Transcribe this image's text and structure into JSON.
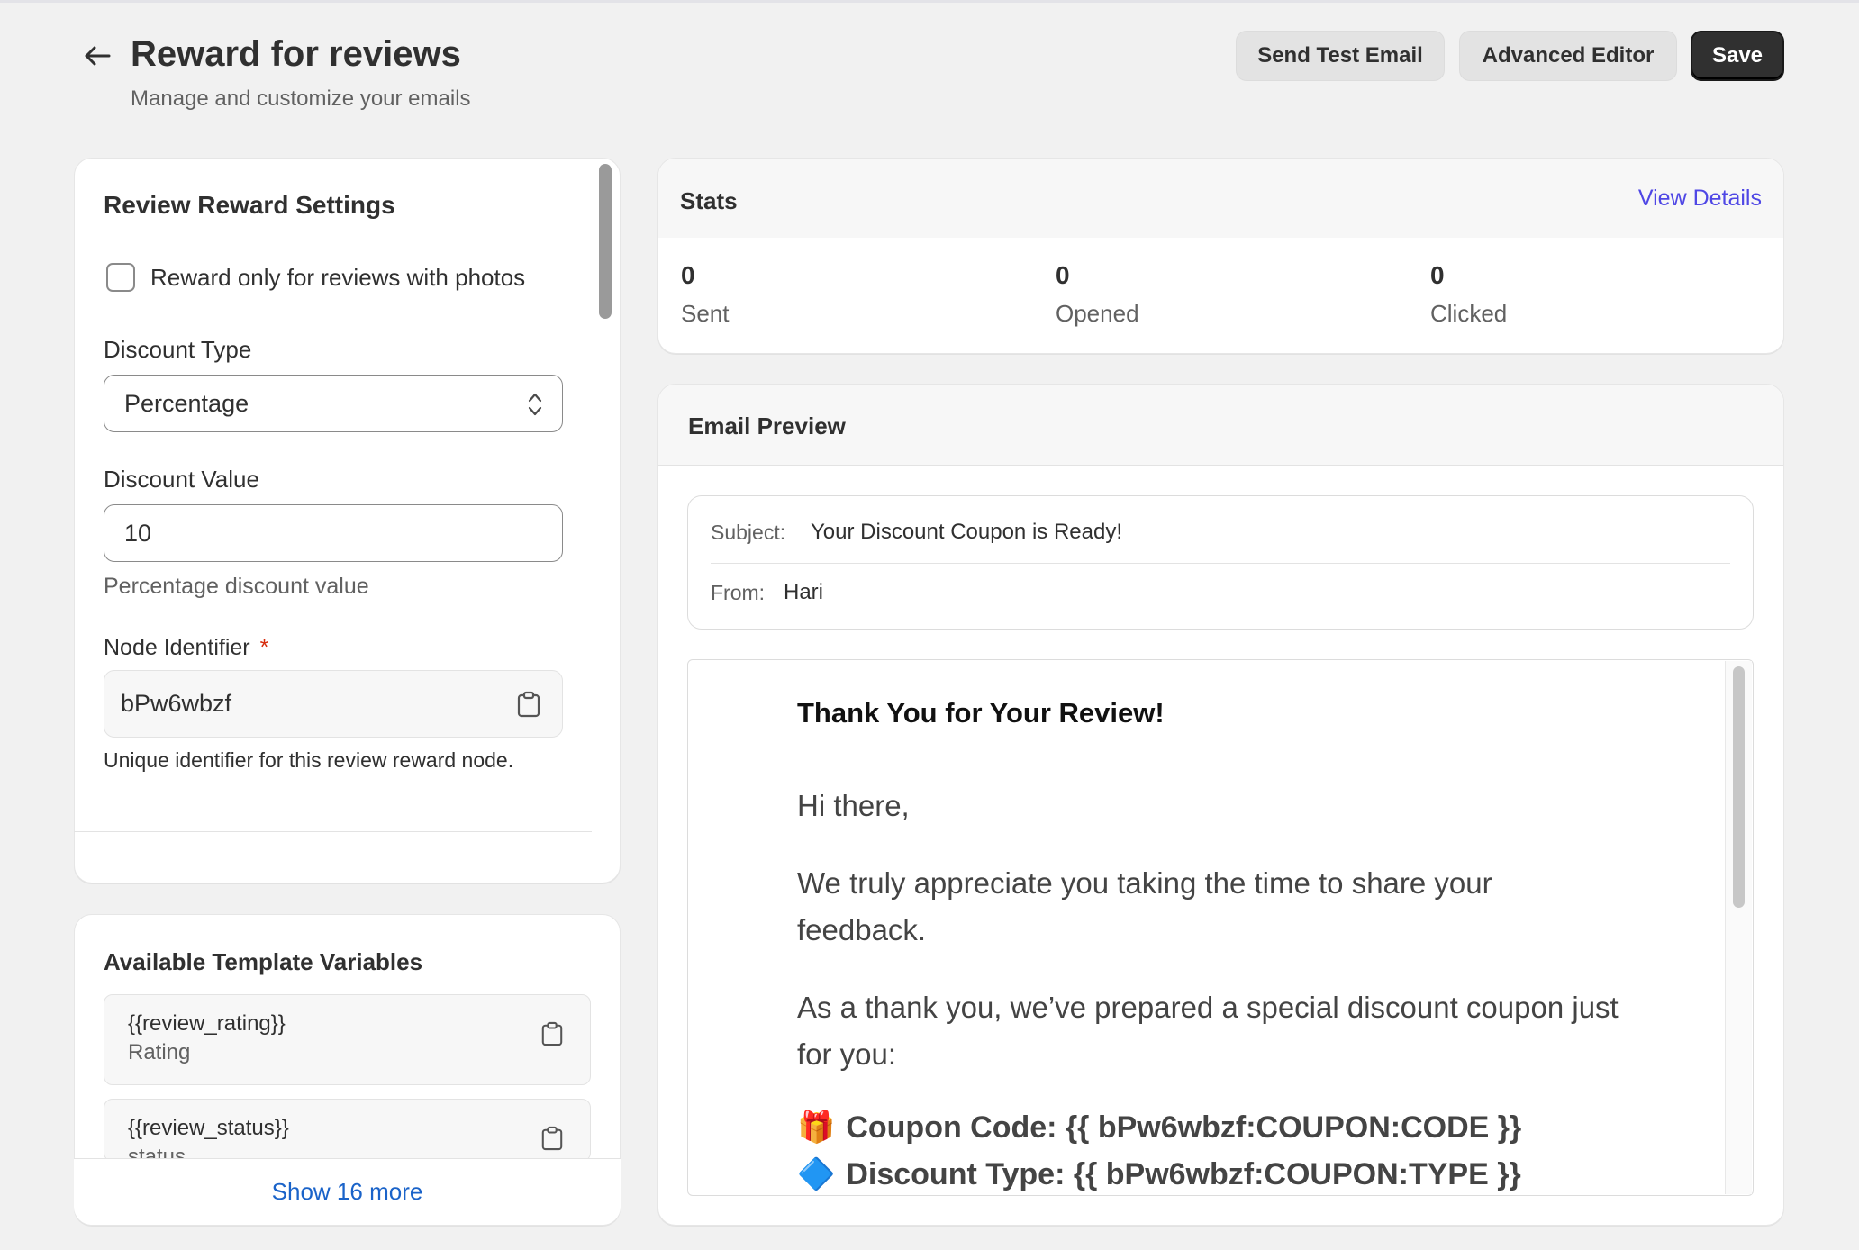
{
  "header": {
    "title": "Reward for reviews",
    "subtitle": "Manage and customize your emails",
    "send_test_label": "Send Test Email",
    "advanced_editor_label": "Advanced Editor",
    "save_label": "Save"
  },
  "settings": {
    "title": "Review Reward Settings",
    "photos_only_label": "Reward only for reviews with photos",
    "photos_only_checked": false,
    "discount_type_label": "Discount Type",
    "discount_type_value": "Percentage",
    "discount_value_label": "Discount Value",
    "discount_value": "10",
    "discount_value_help": "Percentage discount value",
    "node_identifier_label": "Node Identifier",
    "required_mark": "*",
    "node_identifier_value": "bPw6wbzf",
    "node_identifier_help": "Unique identifier for this review reward node."
  },
  "variables": {
    "title": "Available Template Variables",
    "items": [
      {
        "name": "{{review_rating}}",
        "desc": "Rating"
      },
      {
        "name": "{{review_status}}",
        "desc": "status"
      }
    ],
    "show_more_label": "Show 16 more"
  },
  "stats": {
    "title": "Stats",
    "view_details_label": "View Details",
    "items": [
      {
        "value": "0",
        "label": "Sent"
      },
      {
        "value": "0",
        "label": "Opened"
      },
      {
        "value": "0",
        "label": "Clicked"
      }
    ]
  },
  "preview": {
    "title": "Email Preview",
    "subject_key": "Subject:",
    "subject_value": "Your Discount Coupon is Ready!",
    "from_key": "From:",
    "from_value": "Hari",
    "heading": "Thank You for Your Review!",
    "greeting": "Hi there,",
    "paragraph1": "We truly appreciate you taking the time to share your feedback.",
    "paragraph2": "As a thank you, we’ve prepared a special discount coupon just for you:",
    "coupon_code_line": "Coupon Code: {{ bPw6wbzf:COUPON:CODE }}",
    "discount_type_line": "Discount Type: {{ bPw6wbzf:COUPON:TYPE }}",
    "coupon_emoji": "🎁",
    "discount_emoji": "🔷"
  },
  "colors": {
    "background": "#f1f1f1",
    "primary_button": "#303030",
    "link_purple": "#4f47e5",
    "link_blue": "#1a63c9",
    "required": "#d72c0d"
  },
  "icons": {
    "back": "arrow-left-icon",
    "select": "chevron-up-down-icon",
    "copy": "clipboard-icon"
  }
}
